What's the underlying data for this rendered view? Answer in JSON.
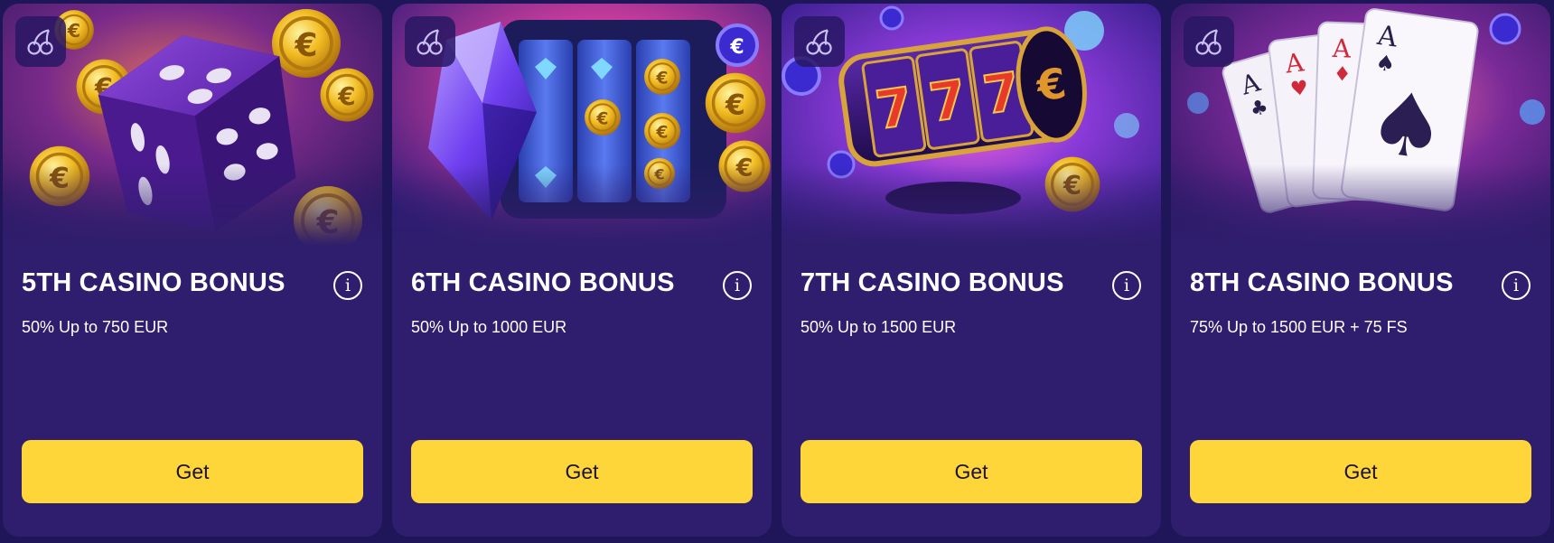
{
  "bonuses": [
    {
      "title": "5TH CASINO BONUS",
      "offer": "50% Up to 750 EUR",
      "button": "Get",
      "info_icon": "info-icon",
      "category_icon": "cherries-icon",
      "art": "purple-dice-with-euro-coins",
      "info_glyph": "i"
    },
    {
      "title": "6TH CASINO BONUS",
      "offer": "50% Up to 1000 EUR",
      "button": "Get",
      "info_icon": "info-icon",
      "category_icon": "cherries-icon",
      "art": "slot-reels-with-diamonds-and-coins",
      "info_glyph": "i"
    },
    {
      "title": "7TH CASINO BONUS",
      "offer": "50% Up to 1500 EUR",
      "button": "Get",
      "info_icon": "info-icon",
      "category_icon": "cherries-icon",
      "art": "777-slot-drum",
      "info_glyph": "i"
    },
    {
      "title": "8TH CASINO BONUS",
      "offer": "75% Up to 1500 EUR + 75 FS",
      "button": "Get",
      "info_icon": "info-icon",
      "category_icon": "cherries-icon",
      "art": "four-aces-playing-cards",
      "info_glyph": "i"
    }
  ],
  "colors": {
    "card_bg": "#2f1e6d",
    "page_bg": "#1e1658",
    "button_bg": "#ffd63a",
    "button_text": "#1d1238",
    "text": "#ffffff"
  }
}
